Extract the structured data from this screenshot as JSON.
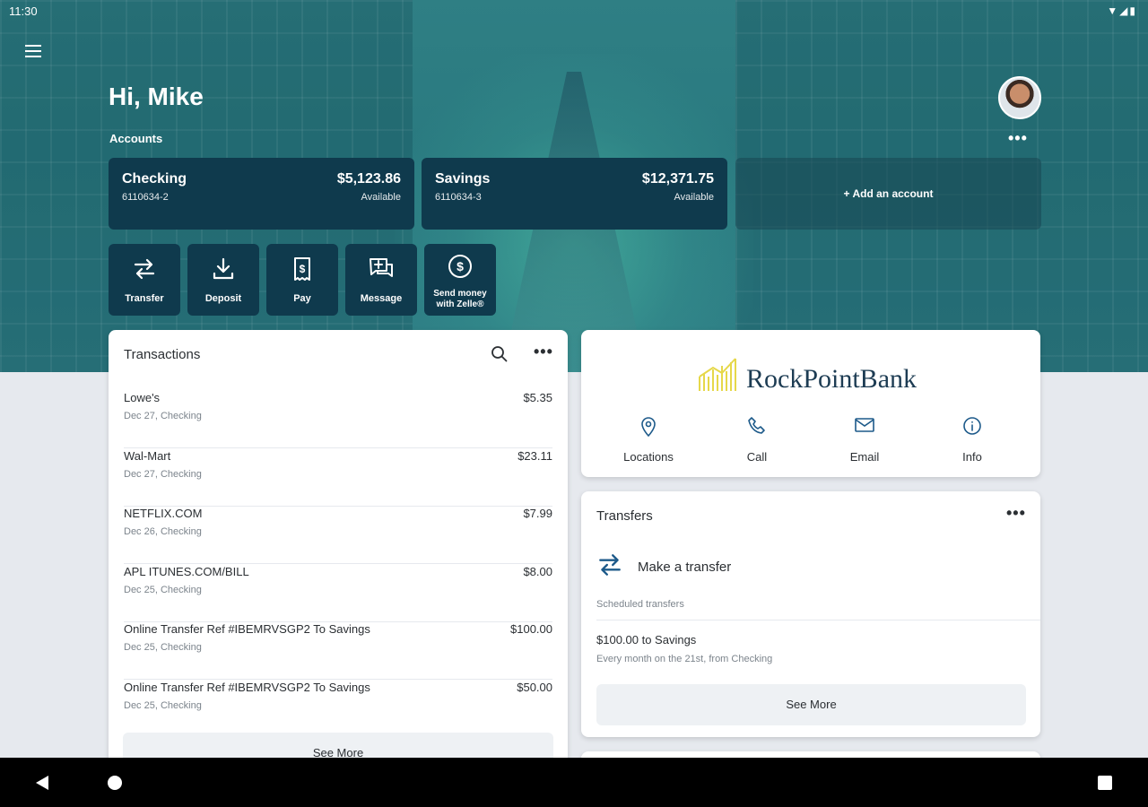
{
  "status_bar": {
    "time": "11:30",
    "icons": "▼◢▮"
  },
  "header": {
    "greeting": "Hi, Mike",
    "accounts_label": "Accounts",
    "more": "•••"
  },
  "accounts": [
    {
      "name": "Checking",
      "number": "6110634-2",
      "balance": "$5,123.86",
      "balance_label": "Available"
    },
    {
      "name": "Savings",
      "number": "6110634-3",
      "balance": "$12,371.75",
      "balance_label": "Available"
    }
  ],
  "add_account": "+ Add an account",
  "actions": [
    {
      "label": "Transfer",
      "icon": "transfer-icon"
    },
    {
      "label": "Deposit",
      "icon": "deposit-icon"
    },
    {
      "label": "Pay",
      "icon": "pay-icon"
    },
    {
      "label": "Message",
      "icon": "message-icon"
    },
    {
      "label": "Send money with Zelle®",
      "icon": "dollar-circle-icon"
    }
  ],
  "transactions": {
    "title": "Transactions",
    "more": "•••",
    "rows": [
      {
        "desc": "Lowe's",
        "sub": "Dec 27, Checking",
        "amount": "$5.35"
      },
      {
        "desc": "Wal-Mart",
        "sub": "Dec 27, Checking",
        "amount": "$23.11"
      },
      {
        "desc": "NETFLIX.COM",
        "sub": "Dec 26, Checking",
        "amount": "$7.99"
      },
      {
        "desc": "APL ITUNES.COM/BILL",
        "sub": "Dec 25, Checking",
        "amount": "$8.00"
      },
      {
        "desc": "Online Transfer Ref #IBEMRVSGP2 To Savings",
        "sub": "Dec 25, Checking",
        "amount": "$100.00"
      },
      {
        "desc": "Online Transfer Ref #IBEMRVSGP2 To Savings",
        "sub": "Dec 25, Checking",
        "amount": "$50.00"
      }
    ],
    "see_more": "See More"
  },
  "bank": {
    "name": "RockPointBank",
    "actions": [
      {
        "label": "Locations",
        "icon": "location-pin-icon"
      },
      {
        "label": "Call",
        "icon": "phone-icon"
      },
      {
        "label": "Email",
        "icon": "email-icon"
      },
      {
        "label": "Info",
        "icon": "info-icon"
      }
    ]
  },
  "transfers": {
    "title": "Transfers",
    "more": "•••",
    "make_transfer": "Make a transfer",
    "scheduled_label": "Scheduled transfers",
    "scheduled_title": "$100.00 to Savings",
    "scheduled_sub": "Every month on the 21st, from Checking",
    "see_more": "See More"
  },
  "colors": {
    "tile": "#0f3a4d",
    "accent": "#1d5a8a",
    "logo": "#e6d84a"
  }
}
